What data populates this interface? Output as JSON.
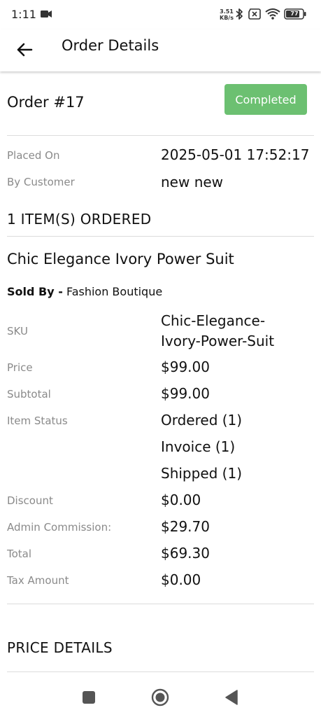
{
  "status_bar": {
    "time": "1:11",
    "net_speed_value": "3.51",
    "net_speed_unit": "KB/s",
    "battery_level": "77",
    "icons": [
      "video-record-icon",
      "bluetooth-icon",
      "no-sim-icon",
      "wifi-icon",
      "battery-icon"
    ]
  },
  "app_bar": {
    "title": "Order Details",
    "back_icon": "arrow-left-icon"
  },
  "order": {
    "title": "Order #17",
    "status": "Completed",
    "status_color": "#6cc071",
    "placed_on_label": "Placed On",
    "placed_on_value": "2025-05-01 17:52:17",
    "customer_label": "By Customer",
    "customer_value": "new new"
  },
  "items_heading": "1 ITEM(S) ORDERED",
  "item": {
    "name": "Chic Elegance Ivory Power Suit",
    "sold_by_label": "Sold By -",
    "sold_by_value": "Fashion Boutique",
    "sku_label": "SKU",
    "sku_line1": "Chic-Elegance-",
    "sku_line2": "Ivory-Power-Suit",
    "price_label": "Price",
    "price_value": "$99.00",
    "subtotal_label": "Subtotal",
    "subtotal_value": "$99.00",
    "item_status_label": "Item Status",
    "item_status_values": [
      "Ordered (1)",
      "Invoice (1)",
      "Shipped (1)"
    ],
    "discount_label": "Discount",
    "discount_value": "$0.00",
    "commission_label": "Admin Commission:",
    "commission_value": "$29.70",
    "total_label": "Total",
    "total_value": "$69.30",
    "tax_label": "Tax Amount",
    "tax_value": "$0.00"
  },
  "price_details_heading": "PRICE DETAILS",
  "nav_bar": {
    "icons": [
      "recents-square-icon",
      "home-circle-icon",
      "back-triangle-icon"
    ]
  }
}
